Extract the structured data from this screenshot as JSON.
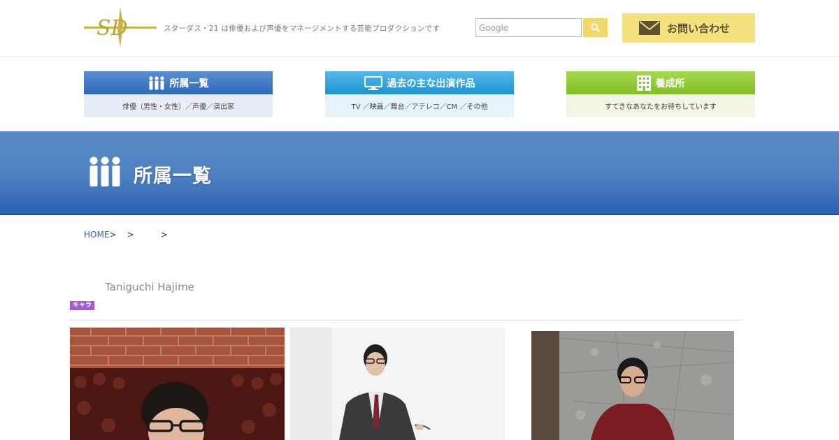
{
  "header": {
    "logo_text": "SD",
    "tagline": "スターダス・21 は俳優および声優をマネージメントする芸能プロダクションです",
    "search": {
      "placeholder": "Google",
      "value": ""
    },
    "search_icon": "magnifier-icon",
    "contact_label": "お問い合わせ",
    "contact_icon": "envelope-icon"
  },
  "categories": [
    {
      "title": "所属一覧",
      "subtitle": "俳優（男性・女性）／声優／演出家",
      "icon": "people-icon"
    },
    {
      "title": "過去の主な出演作品",
      "subtitle": "TV ／映画／舞台／アテレコ／CM ／その他",
      "icon": "tv-monitor-icon"
    },
    {
      "title": "養成所",
      "subtitle": "すてきなあなたをお待ちしています",
      "icon": "building-icon"
    }
  ],
  "banner": {
    "title": "所属一覧",
    "icon": "people-icon"
  },
  "breadcrumb": {
    "home": "HOME",
    "rest": ">    >          >"
  },
  "profile": {
    "romaji": "Taniguchi Hajime",
    "badge": "キャラ"
  },
  "colors": {
    "accent_yellow": "#f3e27f",
    "blue": "#2d68bb",
    "sky": "#1d94d2",
    "green": "#80bf25",
    "badge_purple": "#a358d6"
  }
}
